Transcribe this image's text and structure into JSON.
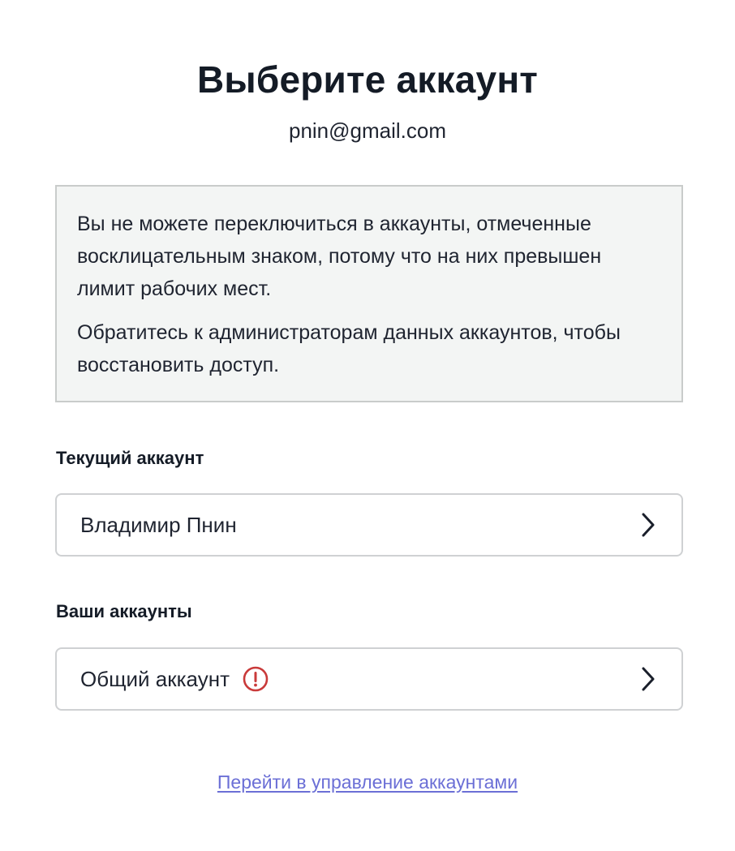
{
  "header": {
    "title": "Выберите аккаунт",
    "email": "pnin@gmail.com"
  },
  "notice": {
    "paragraph_1": "Вы не можете переключиться в аккаунты, отмеченные восклицательным знаком, потому что на них превышен лимит рабочих мест.",
    "paragraph_2": "Обратитесь к администраторам данных аккаунтов, чтобы восстановить доступ."
  },
  "current_account": {
    "label": "Текущий аккаунт",
    "name": "Владимир Пнин"
  },
  "your_accounts": {
    "label": "Ваши аккаунты",
    "items": [
      {
        "name": "Общий аккаунт",
        "warning_icon": "exclamation-circle-icon",
        "status": "seat-limit-exceeded"
      }
    ]
  },
  "manage_link": {
    "label": "Перейти в управление аккаунтами"
  },
  "colors": {
    "text": "#1f2430",
    "notice_bg": "#f3f5f4",
    "warning": "#c93a3a",
    "link": "#6b6fd6"
  }
}
